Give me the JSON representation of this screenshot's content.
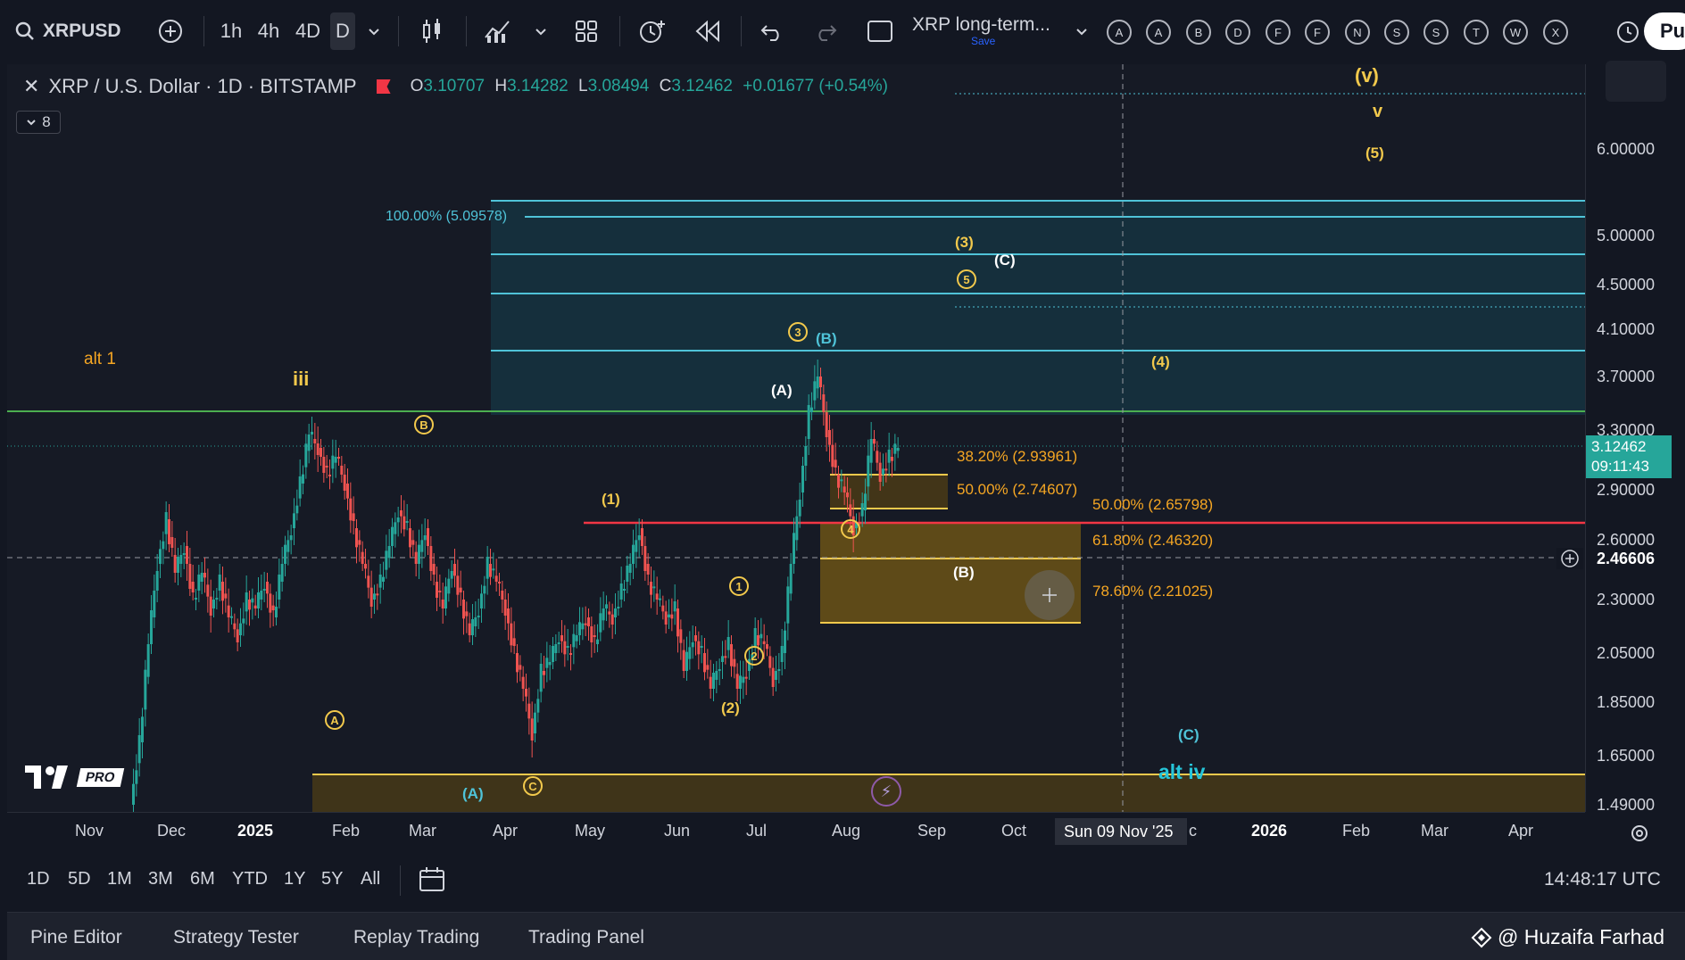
{
  "toolbar": {
    "symbol": "XRPUSD",
    "intervals": [
      "1h",
      "4h",
      "4D",
      "D"
    ],
    "layout_name": "XRP long-term...",
    "layout_sub": "Save",
    "drawing_letters": [
      "A",
      "A",
      "B",
      "D",
      "F",
      "F",
      "N",
      "S",
      "S",
      "T",
      "W",
      "X"
    ],
    "publish_label": "Pul"
  },
  "legend": {
    "title": "XRP / U.S. Dollar · 1D · BITSTAMP",
    "o_label": "O",
    "o": "3.10707",
    "h_label": "H",
    "h": "3.14282",
    "l_label": "L",
    "l": "3.08494",
    "c_label": "C",
    "c": "3.12462",
    "change": "+0.01677 (+0.54%)",
    "indicators_count": "8"
  },
  "price_axis": {
    "ticks": [
      "6.00000",
      "5.00000",
      "4.50000",
      "4.10000",
      "3.70000",
      "3.30000",
      "2.90000",
      "2.60000",
      "2.30000",
      "2.05000",
      "1.85000",
      "1.65000",
      "1.49000"
    ],
    "current_price": "3.12462",
    "countdown": "09:11:43",
    "crosshair_price": "2.46606"
  },
  "time_axis": {
    "ticks": [
      "Nov",
      "Dec",
      "2025",
      "Feb",
      "Mar",
      "Apr",
      "May",
      "Jun",
      "Jul",
      "Aug",
      "Sep",
      "Oct",
      "c",
      "2026",
      "Feb",
      "Mar",
      "Apr"
    ],
    "crosshair_date": "Sun 09 Nov '25"
  },
  "annotations": {
    "alt1": "alt 1",
    "iii": "iii",
    "v_big": "(v)",
    "v_small": "v",
    "w5": "(5)",
    "w3": "(3)",
    "wC_top": "(C)",
    "w4": "(4)",
    "wB_teal": "(B)",
    "wA": "(A)",
    "w1": "(1)",
    "w2": "(2)",
    "wB_box": "(B)",
    "wC_teal": "(C)",
    "alt_iv": "alt iv",
    "wA_teal": "(A)",
    "c_circles": [
      "B",
      "A",
      "C",
      "1",
      "2",
      "3",
      "4",
      "5"
    ]
  },
  "fib_levels": {
    "f100": "100.00% (5.09578)",
    "f382": "38.20% (2.93961)",
    "f50a": "50.00% (2.74607)",
    "f50b": "50.00% (2.65798)",
    "f618": "61.80% (2.46320)",
    "f786": "78.60% (2.21025)"
  },
  "range_bar": {
    "ranges": [
      "1D",
      "5D",
      "1M",
      "3M",
      "6M",
      "YTD",
      "1Y",
      "5Y",
      "All"
    ],
    "clock": "14:48:17 UTC"
  },
  "bottom_tabs": [
    "Pine Editor",
    "Strategy Tester",
    "Replay Trading",
    "Trading Panel"
  ],
  "watermark": "@ Huzaifa Farhad",
  "logo_badge": "PRO",
  "colors": {
    "up": "#26a69a",
    "down": "#ef5350",
    "accent_orange": "#f2c94c",
    "teal": "#4fc3d8",
    "green_line": "#4caf50",
    "red_line": "#f23645"
  }
}
